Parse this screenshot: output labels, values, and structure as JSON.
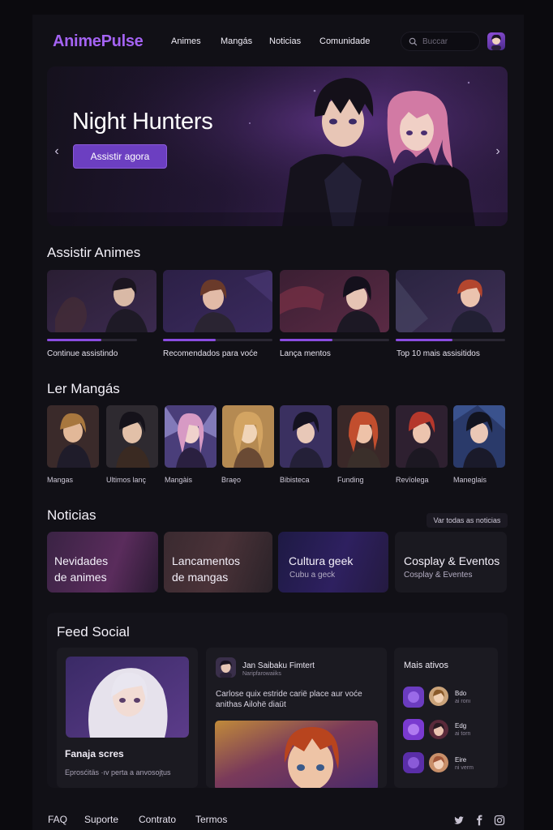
{
  "header": {
    "logo": "AnimePulse",
    "nav": [
      "Animes",
      "Mangás",
      "Noticias",
      "Comunidade"
    ],
    "search_placeholder": "Buccar"
  },
  "hero": {
    "title": "Night Hunters",
    "button": "Assistir agora"
  },
  "watch": {
    "title": "Assistir Animes",
    "cards": [
      {
        "label": "Continue assistindo",
        "progress": 0.6
      },
      {
        "label": "Recomendados para voće",
        "progress": 0.48
      },
      {
        "label": "Lança mentos",
        "progress": 0.48
      },
      {
        "label": "Top 10 mais assisitidos",
        "progress": 0.52
      }
    ]
  },
  "manga": {
    "title": "Ler Mangás",
    "items": [
      "Mangas",
      "Ultimos lanç",
      "Mangàis",
      "Braęo",
      "Bibisteca",
      "Funding",
      "Revïolega",
      "Maneglais"
    ]
  },
  "news": {
    "title": "Noticias",
    "see_all": "Var todas as noticias",
    "cards": [
      {
        "title_l1": "Nevidades",
        "title_l2": "de animes",
        "sub": ""
      },
      {
        "title_l1": "Lancamentos",
        "title_l2": "de mangas",
        "sub": ""
      },
      {
        "title_l1": "Cultura geek",
        "title_l2": "",
        "sub": "Cubu a geck"
      },
      {
        "title_l1": "Cosplay & Eventos",
        "title_l2": "",
        "sub": "Cosplay & Eventes"
      }
    ]
  },
  "feed": {
    "title": "Feed Social",
    "left_card": {
      "title": "Fanaja scres",
      "sub": "Eprosćitäs ·ıv perta a anvosojțus"
    },
    "post": {
      "user": "Jan Saibaku  Fimtert",
      "handle": "Naripfarowaiiks",
      "text_l1": "Carlose quix estride carië place aur voće",
      "text_l2": "anithas Ailohë diaüt"
    },
    "active": {
      "title": "Mais ativos",
      "users": [
        {
          "name": "Bdo",
          "sub": "ai ronı"
        },
        {
          "name": "Edg",
          "sub": "ai torn"
        },
        {
          "name": "Eire",
          "sub": "ni verm"
        }
      ]
    }
  },
  "footer": {
    "links": [
      "FAQ",
      "Suporte",
      "Contrato",
      "Termos"
    ]
  },
  "colors": {
    "accent": "#8a4ce0",
    "logo": "#a463f2",
    "background": "#0b0a0e"
  }
}
